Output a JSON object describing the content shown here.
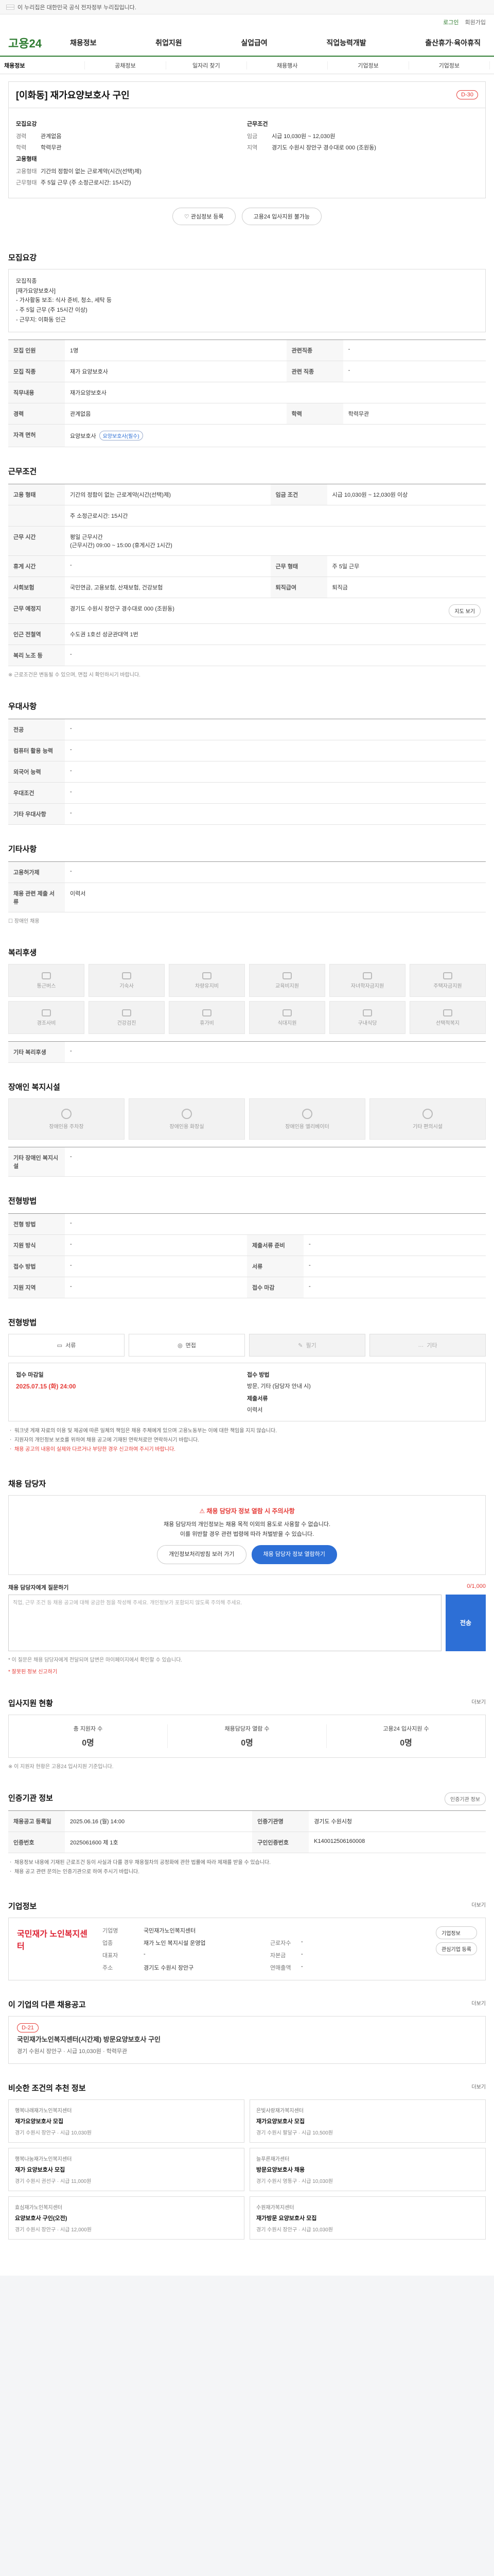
{
  "topbar": {
    "notice": "이 누리집은 대한민국 공식 전자정부 누리집입니다."
  },
  "util": {
    "login": "로그인",
    "join": "회원가입"
  },
  "gnb": {
    "logo": "고용24",
    "menu": [
      "채용정보",
      "취업지원",
      "실업급여",
      "직업능력개발",
      "출산휴가·육아휴직"
    ]
  },
  "subnav": [
    "채용정보",
    "공채정보",
    "일자리 찾기",
    "채용행사",
    "기업정보",
    "기업정보"
  ],
  "job": {
    "title": "[이화동] 재가요양보호사 구인",
    "dday": "D-30",
    "recruit_label": "모집요강",
    "career_k": "경력",
    "career_v": "관계없음",
    "edu_k": "학력",
    "edu_v": "학력무관",
    "cond_label": "근무조건",
    "wage_k": "임금",
    "wage_v": "시급 10,030원 ~ 12,030원",
    "place_k": "지역",
    "place_v": "경기도 수원시 장안구 경수대로 000 (조원동)",
    "emp_label": "고용형태",
    "emp_k1": "고용형태",
    "emp_v1": "기간의 정함이 없는 근로계약(시간(선택)제)",
    "emp_k2": "근무형태",
    "emp_v2": "주 5일 근무 (주 소정근로시간: 15시간)",
    "btn_scrap": "관심정보 등록",
    "btn_apply": "고용24 입사지원 불가능"
  },
  "recruit": {
    "title": "모집요강",
    "content": "모집직종\n[재가요양보호사]\n- 가사활동 보조: 식사 준비, 청소, 세탁 등\n- 주 5일 근무 (주 15시간 이상)\n- 근무지: 이화동 인근",
    "rows": [
      {
        "k": "모집 인원",
        "v": "1명",
        "k2": "관련직종",
        "v2": "-"
      },
      {
        "k": "모집 직종",
        "v": "재가 요양보호사",
        "k2": "관련 직종",
        "v2": "-"
      },
      {
        "k": "직무내용",
        "v": "재가요양보호사",
        "k2": "",
        "v2": ""
      },
      {
        "k": "경력",
        "v": "관계없음",
        "k2": "학력",
        "v2": "학력무관"
      },
      {
        "k": "자격 면허",
        "v": "요양보호사",
        "k2": "",
        "v2": ""
      }
    ],
    "license_tag": "요양보호사(필수)"
  },
  "workcond": {
    "title": "근무조건",
    "rows": [
      {
        "k": "고용 형태",
        "v": "기간의 정함이 없는 근로계약(시간(선택)제)",
        "k2": "임금 조건",
        "v2": "시급 10,030원 ~ 12,030원 이상"
      },
      {
        "k": "",
        "v": "주 소정근로시간: 15시간",
        "k2": "",
        "v2": ""
      },
      {
        "k": "근무 시간",
        "v": "평일 근무시간\n(근무시간) 09:00 ~ 15:00 (휴게시간 1시간)",
        "k2": "",
        "v2": ""
      },
      {
        "k": "휴게 시간",
        "v": "-",
        "k2": "근무 형태",
        "v2": "주 5일 근무"
      },
      {
        "k": "사회보험",
        "v": "국민연금, 고용보험, 산재보험, 건강보험",
        "k2": "퇴직급여",
        "v2": "퇴직금"
      },
      {
        "k": "근무 예정지",
        "v": "경기도 수원시 장안구 경수대로 000 (조원동)",
        "k2": "",
        "v2": ""
      },
      {
        "k": "인근 전철역",
        "v": "수도권 1호선 성균관대역 1번",
        "k2": "",
        "v2": ""
      },
      {
        "k": "복리 노조 등",
        "v": "-",
        "k2": "",
        "v2": ""
      }
    ],
    "map_btn": "지도 보기",
    "note": "※ 근로조건은 변동될 수 있으며, 면접 시 확인하시기 바랍니다."
  },
  "prefer": {
    "title": "우대사항",
    "rows": [
      {
        "k": "전공",
        "v": "-"
      },
      {
        "k": "컴퓨터 활용 능력",
        "v": "-"
      },
      {
        "k": "외국어 능력",
        "v": "-"
      },
      {
        "k": "우대조건",
        "v": "-"
      },
      {
        "k": "기타 우대사항",
        "v": "-"
      }
    ]
  },
  "other": {
    "title": "기타사항",
    "rows": [
      {
        "k": "고용허가제",
        "v": "-"
      },
      {
        "k": "채용 관련 제출 서류",
        "v": "이력서"
      }
    ],
    "check": "장애인 채용"
  },
  "welfare": {
    "title": "복리후생",
    "items": [
      "통근버스",
      "기숙사",
      "차량유지비",
      "교육비지원",
      "자녀학자금지원",
      "주택자금지원",
      "경조사비",
      "건강검진",
      "휴가비",
      "식대지원",
      "구내식당",
      "선택적복지"
    ],
    "etc_k": "기타 복리후생",
    "etc_v": "-"
  },
  "disabled": {
    "title": "장애인 복지시설",
    "items": [
      "장애인용 주차장",
      "장애인용 화장실",
      "장애인용 엘리베이터",
      "기타 편의시설"
    ],
    "etc_k": "기타 장애인 복지시설",
    "etc_v": "-"
  },
  "screening": {
    "title": "전형방법",
    "rows": [
      {
        "k": "전형 방법",
        "v": "-",
        "k2": "",
        "v2": ""
      },
      {
        "k": "지원 방식",
        "v": "-",
        "k2": "제출서류 준비",
        "v2": "-"
      },
      {
        "k": "접수 방법",
        "v": "-",
        "k2": "서류",
        "v2": "-"
      },
      {
        "k": "지원 지역",
        "v": "-",
        "k2": "접수 마감",
        "v2": "-"
      }
    ]
  },
  "method": {
    "title": "전형방법",
    "items": [
      "서류",
      "면접",
      "필기",
      "기타"
    ]
  },
  "period": {
    "label1": "접수 마감일",
    "date1": "2025.07.15 (화) 24:00",
    "label2": "접수 방법",
    "v2": "방문, 기타 (담당자 안내 시)",
    "label3": "제출서류",
    "v3": "이력서"
  },
  "bullets": [
    "ㆍ 워크넷 게재 자료의 이용 및 제공에 따른 일체의 책임은 채용 주체에게 있으며 고용노동부는 이에 대한 책임을 지지 않습니다.",
    "ㆍ 지원자의 개인정보 보호를 위하여 채용 공고에 기재된 연락처로만 연락하시기 바랍니다.",
    "ㆍ 채용 공고의 내용이 실제와 다르거나 부당한 경우 신고하여 주시기 바랍니다."
  ],
  "contact": {
    "title": "채용 담당자",
    "warn": "채용 담당자 정보 열람 시 주의사항",
    "text": "채용 담당자의 개인정보는 채용 목적 이외의 용도로 사용할 수 없습니다.\n이를 위반할 경우 관련 법령에 따라 처벌받을 수 있습니다.",
    "btn1": "개인정보처리방침 보러 가기",
    "btn2": "채용 담당자 정보 열람하기",
    "inq_title": "채용 담당자에게 질문하기",
    "inq_count": "0/1,000",
    "placeholder": "직업, 근무 조건 등 채용 공고에 대해 궁금한 점을 작성해 주세요. 개인정보가 포함되지 않도록 주의해 주세요.",
    "send": "전송",
    "note1": "* 이 질문은 채용 담당자에게 전달되며 답변은 마이페이지에서 확인할 수 있습니다.",
    "note2": "* 잘못된 정보 신고하기"
  },
  "applystat": {
    "title": "입사지원 현황",
    "more": "더보기",
    "items": [
      {
        "label": "총 지원자 수",
        "n": "0명"
      },
      {
        "label": "채용담당자 열람 수",
        "n": "0명"
      },
      {
        "label": "고용24 입사지원 수",
        "n": "0명"
      }
    ],
    "note": "※ 이 지원자 현황은 고용24 입사지원 기준입니다."
  },
  "institution": {
    "title": "인증기관 정보",
    "btn": "인증기관 정보",
    "rows": [
      {
        "k": "채용공고 등록일",
        "v": "2025.06.16 (월) 14:00",
        "k2": "인증기관명",
        "v2": "경기도 수원시청"
      },
      {
        "k": "인증번호",
        "v": "2025061600 제 1호",
        "k2": "구인인증번호",
        "v2": "K140012506160008"
      }
    ],
    "note1": "ㆍ 채용정보 내용에 기재된 근로조건 등이 사실과 다를 경우 채용절차의 공정화에 관한 법률에 따라 제재를 받을 수 있습니다.",
    "note2": "ㆍ 채용 공고 관련 문의는 인증기관으로 하여 주시기 바랍니다."
  },
  "companyinfo": {
    "title": "기업정보",
    "more": "더보기",
    "logo": "국민재가 노인복지센터",
    "rows": [
      {
        "k": "기업명",
        "v": "국민재가노인복지센터",
        "k2": "",
        "v2": ""
      },
      {
        "k": "업종",
        "v": "재가 노인 복지시설 운영업",
        "k2": "근로자수",
        "v2": "-"
      },
      {
        "k": "대표자",
        "v": "-",
        "k2": "자본금",
        "v2": "-"
      },
      {
        "k": "주소",
        "v": "경기도 수원시 장안구",
        "k2": "연매출액",
        "v2": "-"
      }
    ],
    "btn1": "기업정보",
    "btn2": "관심기업 등록"
  },
  "relatedjob": {
    "title": "이 기업의 다른 채용공고",
    "more": "더보기",
    "dday": "D-21",
    "rt": "국민재가노인복지센터(시간제) 방문요양보호사 구인",
    "rm": "경기 수원시 장안구 · 시급 10,030원 · 학력무관"
  },
  "similar": {
    "title": "비슷한 조건의 추천 정보",
    "more": "더보기",
    "cards": [
      {
        "co": "행복나래재가노인복지센터",
        "ct": "재가요양보호사 모집",
        "cm": "경기 수원시 장안구 · 시급 10,030원"
      },
      {
        "co": "은빛사랑재가복지센터",
        "ct": "재가요양보호사 모집",
        "cm": "경기 수원시 팔달구 · 시급 10,500원"
      },
      {
        "co": "행복나눔재가노인복지센터",
        "ct": "재가 요양보호사 모집",
        "cm": "경기 수원시 권선구 · 시급 11,000원"
      },
      {
        "co": "늘푸른재가센터",
        "ct": "방문요양보호사 채용",
        "cm": "경기 수원시 영통구 · 시급 10,030원"
      },
      {
        "co": "효심재가노인복지센터",
        "ct": "요양보호사 구인(오전)",
        "cm": "경기 수원시 장안구 · 시급 12,000원"
      },
      {
        "co": "수원재가복지센터",
        "ct": "재가방문 요양보호사 모집",
        "cm": "경기 수원시 장안구 · 시급 10,030원"
      }
    ]
  }
}
